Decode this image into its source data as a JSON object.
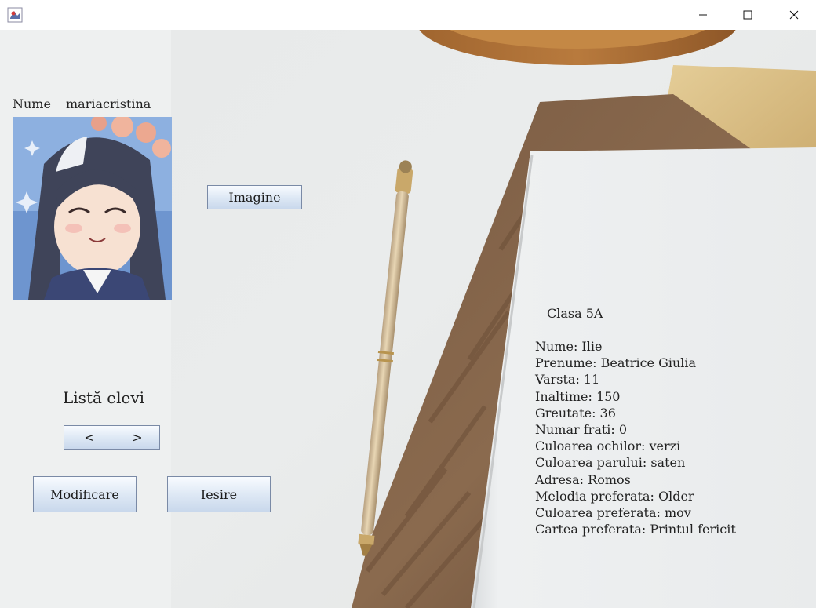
{
  "window": {
    "minimize_glyph": "—",
    "maximize_glyph": "☐",
    "close_glyph": "✕"
  },
  "student": {
    "name_label": "Nume",
    "name_value": "mariacristina",
    "image_button": "Imagine"
  },
  "list": {
    "title": "Listă elevi",
    "prev": "<",
    "next": ">"
  },
  "actions": {
    "modify": "Modificare",
    "exit": "Iesire"
  },
  "details": {
    "class": "Clasa 5A",
    "lines": [
      "Nume: Ilie",
      "Prenume: Beatrice Giulia",
      "Varsta: 11",
      "Inaltime: 150",
      "Greutate: 36",
      "Numar frati: 0",
      "Culoarea ochilor: verzi",
      "Culoarea parului: saten",
      "Adresa: Romos",
      "Melodia preferata: Older",
      "Culoarea preferata: mov",
      "Cartea preferata: Printul fericit"
    ]
  },
  "colors": {
    "button_border": "#7a8aa6",
    "button_top": "#f8fbff",
    "button_bottom": "#c9d8ec"
  }
}
